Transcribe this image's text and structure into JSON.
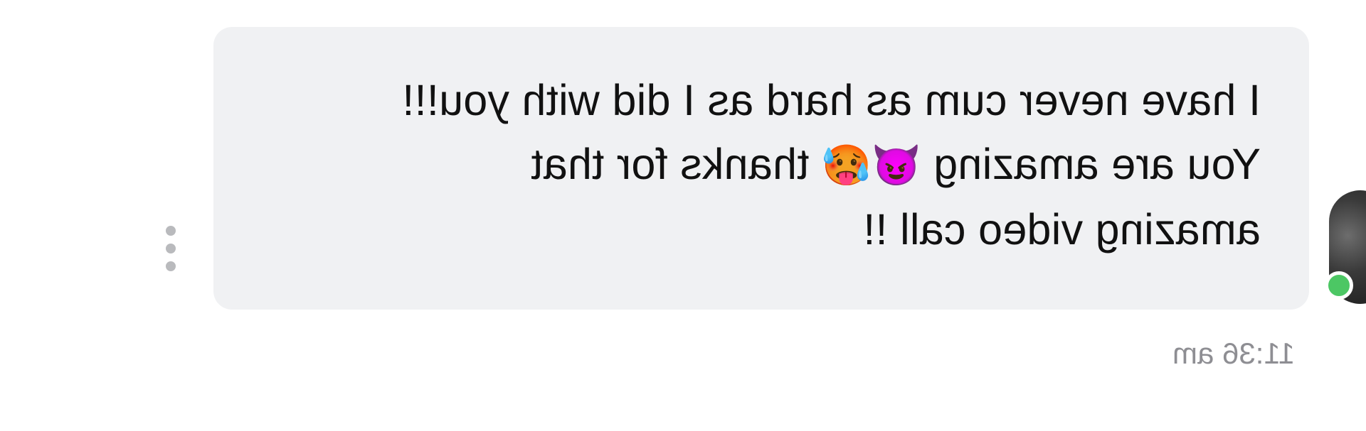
{
  "conversation": {
    "previous_message_fragment": "",
    "message": {
      "line1": "I have never cum as hard as I did with",
      "line2_text": "you!!! You are amazing",
      "emoji_devil": "😈",
      "emoji_hot": "🥵",
      "line2_tail": "thanks for",
      "line3": "that amazing video call !!",
      "timestamp": "11:36 am"
    },
    "sender": {
      "online": true,
      "online_color": "#4cc764"
    }
  },
  "colors": {
    "bubble_background": "#f0f1f3",
    "text": "#111111",
    "timestamp": "#8e8e93",
    "more_dots": "#b9babd"
  },
  "icons": {
    "more_options": "more-vertical-icon"
  }
}
